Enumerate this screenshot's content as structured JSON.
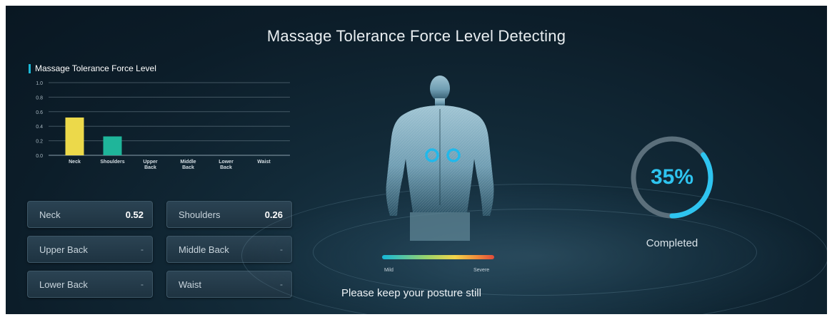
{
  "header": {
    "title": "Massage Tolerance Force Level Detecting"
  },
  "chart_data": {
    "type": "bar",
    "title": "Massage Tolerance Force Level",
    "xlabel": "",
    "ylabel": "",
    "ylim": [
      0,
      1.0
    ],
    "yticks": [
      "0.0",
      "0.2",
      "0.4",
      "0.6",
      "0.8",
      "1.0"
    ],
    "categories": [
      "Neck",
      "Shoulders",
      "Upper Back",
      "Middle Back",
      "Lower Back",
      "Waist"
    ],
    "values": [
      0.52,
      0.26,
      0,
      0,
      0,
      0
    ],
    "colors": [
      "#ecd94a",
      "#1fb59a",
      "#1fb59a",
      "#1fb59a",
      "#1fb59a",
      "#1fb59a"
    ],
    "grid": true
  },
  "cards": [
    {
      "label": "Neck",
      "value": "0.52"
    },
    {
      "label": "Shoulders",
      "value": "0.26"
    },
    {
      "label": "Upper Back",
      "value": "-"
    },
    {
      "label": "Middle Back",
      "value": "-"
    },
    {
      "label": "Lower Back",
      "value": "-"
    },
    {
      "label": "Waist",
      "value": "-"
    }
  ],
  "scale": {
    "min_label": "Mild",
    "max_label": "Severe"
  },
  "hint": "Please keep your posture still",
  "progress": {
    "value": 0.35,
    "label": "35%",
    "caption": "Completed",
    "color": "#2ec4f0"
  },
  "accent": "#1bb8d6"
}
